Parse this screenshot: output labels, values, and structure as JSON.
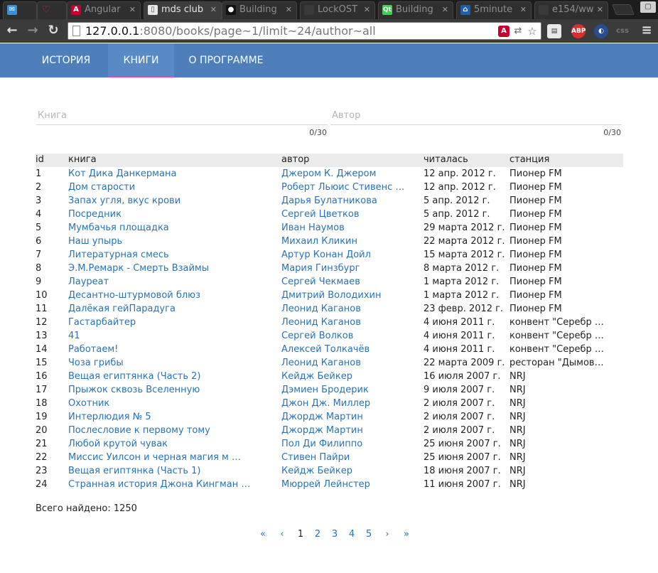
{
  "browser": {
    "tabs": [
      {
        "title": "",
        "icon": "mail-icon",
        "active": false
      },
      {
        "title": "",
        "icon": "heart-icon",
        "active": false
      },
      {
        "title": "Angular",
        "icon": "angular-icon",
        "active": false
      },
      {
        "title": "mds club",
        "icon": "page-icon",
        "active": true
      },
      {
        "title": "Building",
        "icon": "github-icon",
        "active": false
      },
      {
        "title": "LockOST",
        "icon": "page-icon",
        "active": false
      },
      {
        "title": "Building",
        "icon": "qt-icon",
        "active": false
      },
      {
        "title": "5minute",
        "icon": "house-icon",
        "active": false
      },
      {
        "title": "e154/ww",
        "icon": "page-icon",
        "active": false
      }
    ],
    "url_host": "127.0.0.1",
    "url_rest": ":8080/books/page~1/limit~24/author~all",
    "extensions": {
      "abp": "ABP",
      "css": "css"
    }
  },
  "navbar": {
    "items": [
      {
        "label": "ИСТОРИЯ",
        "active": false
      },
      {
        "label": "КНИГИ",
        "active": true
      },
      {
        "label": "О ПРОГРАММЕ",
        "active": false
      }
    ]
  },
  "filters": {
    "book_placeholder": "Книга",
    "book_value": "",
    "book_counter": "0/30",
    "author_placeholder": "Автор",
    "author_value": "",
    "author_counter": "0/30"
  },
  "table": {
    "headers": {
      "id": "id",
      "book": "книга",
      "author": "автор",
      "date": "читалась",
      "station": "станция"
    },
    "rows": [
      {
        "id": "1",
        "book": "Кот Дика Данкермана",
        "author": "Джером К. Джером",
        "date": "12 апр. 2012 г.",
        "station": "Пионер FM"
      },
      {
        "id": "2",
        "book": "Дом старости",
        "author": "Роберт Льюис Стивенс …",
        "date": "12 апр. 2012 г.",
        "station": "Пионер FM"
      },
      {
        "id": "3",
        "book": "Запах угля, вкус крови",
        "author": "Дарья Булатникова",
        "date": "5 апр. 2012 г.",
        "station": "Пионер FM"
      },
      {
        "id": "4",
        "book": "Посредник",
        "author": "Сергей Цветков",
        "date": "5 апр. 2012 г.",
        "station": "Пионер FM"
      },
      {
        "id": "5",
        "book": "Мумбачья площадка",
        "author": "Иван Наумов",
        "date": "29 марта 2012 г.",
        "station": "Пионер FM"
      },
      {
        "id": "6",
        "book": "Наш упырь",
        "author": "Михаил Кликин",
        "date": "22 марта 2012 г.",
        "station": "Пионер FM"
      },
      {
        "id": "7",
        "book": "Литературная смесь",
        "author": "Артур Конан Дойл",
        "date": "15 марта 2012 г.",
        "station": "Пионер FM"
      },
      {
        "id": "8",
        "book": "Э.М.Ремарк - Смерть Взаймы",
        "author": "Мария Гинзбург",
        "date": "8 марта 2012 г.",
        "station": "Пионер FM"
      },
      {
        "id": "9",
        "book": "Лауреат",
        "author": "Сергей Чекмаев",
        "date": "1 марта 2012 г.",
        "station": "Пионер FM"
      },
      {
        "id": "10",
        "book": "Десантно-штурмовой блюз",
        "author": "Дмитрий Володихин",
        "date": "1 марта 2012 г.",
        "station": "Пионер FM"
      },
      {
        "id": "11",
        "book": "Далёкая гейПарадуга",
        "author": "Леонид Каганов",
        "date": "23 февр. 2012 г.",
        "station": "Пионер FM"
      },
      {
        "id": "12",
        "book": "Гастарбайтер",
        "author": "Леонид Каганов",
        "date": "4 июня 2011 г.",
        "station": "конвент \"Серебр …"
      },
      {
        "id": "13",
        "book": "41",
        "author": "Сергей Волков",
        "date": "4 июня 2011 г.",
        "station": "конвент \"Серебр …"
      },
      {
        "id": "14",
        "book": "Работаем!",
        "author": "Алексей Толкачёв",
        "date": "4 июня 2011 г.",
        "station": "конвент \"Серебр …"
      },
      {
        "id": "15",
        "book": "Чоза грибы",
        "author": "Леонид Каганов",
        "date": "22 марта 2009 г.",
        "station": "ресторан \"Дымов …"
      },
      {
        "id": "16",
        "book": "Вещая египтянка (Часть 2)",
        "author": "Кейдж Бейкер",
        "date": "16 июля 2007 г.",
        "station": "NRJ"
      },
      {
        "id": "17",
        "book": "Прыжок сквозь Вселенную",
        "author": "Дэмиен Бродерик",
        "date": "9 июля 2007 г.",
        "station": "NRJ"
      },
      {
        "id": "18",
        "book": "Охотник",
        "author": "Джон Дж. Миллер",
        "date": "2 июля 2007 г.",
        "station": "NRJ"
      },
      {
        "id": "19",
        "book": "Интерлюдия № 5",
        "author": "Джордж Мартин",
        "date": "2 июля 2007 г.",
        "station": "NRJ"
      },
      {
        "id": "20",
        "book": "Послесловие к первому тому",
        "author": "Джордж Мартин",
        "date": "2 июля 2007 г.",
        "station": "NRJ"
      },
      {
        "id": "21",
        "book": "Любой крутой чувак",
        "author": "Пол Ди Филиппо",
        "date": "25 июня 2007 г.",
        "station": "NRJ"
      },
      {
        "id": "22",
        "book": "Миссис Уилсон и черная магия м …",
        "author": "Стивен Пайри",
        "date": "25 июня 2007 г.",
        "station": "NRJ"
      },
      {
        "id": "23",
        "book": "Вещая египтянка (Часть 1)",
        "author": "Кейдж Бейкер",
        "date": "18 июня 2007 г.",
        "station": "NRJ"
      },
      {
        "id": "24",
        "book": "Странная история Джона Кингман …",
        "author": "Мюррей Лейнстер",
        "date": "11 июня 2007 г.",
        "station": "NRJ"
      }
    ]
  },
  "summary": {
    "total": "Всего найдено: 1250"
  },
  "pager": {
    "first": "«",
    "prev": "‹",
    "pages": [
      "1",
      "2",
      "3",
      "4",
      "5"
    ],
    "current": "1",
    "next": "›",
    "last": "»"
  },
  "colors": {
    "navbar": "#4f7fbb",
    "link": "#2a72b5",
    "active_tab_underline": "#e94e8f"
  }
}
